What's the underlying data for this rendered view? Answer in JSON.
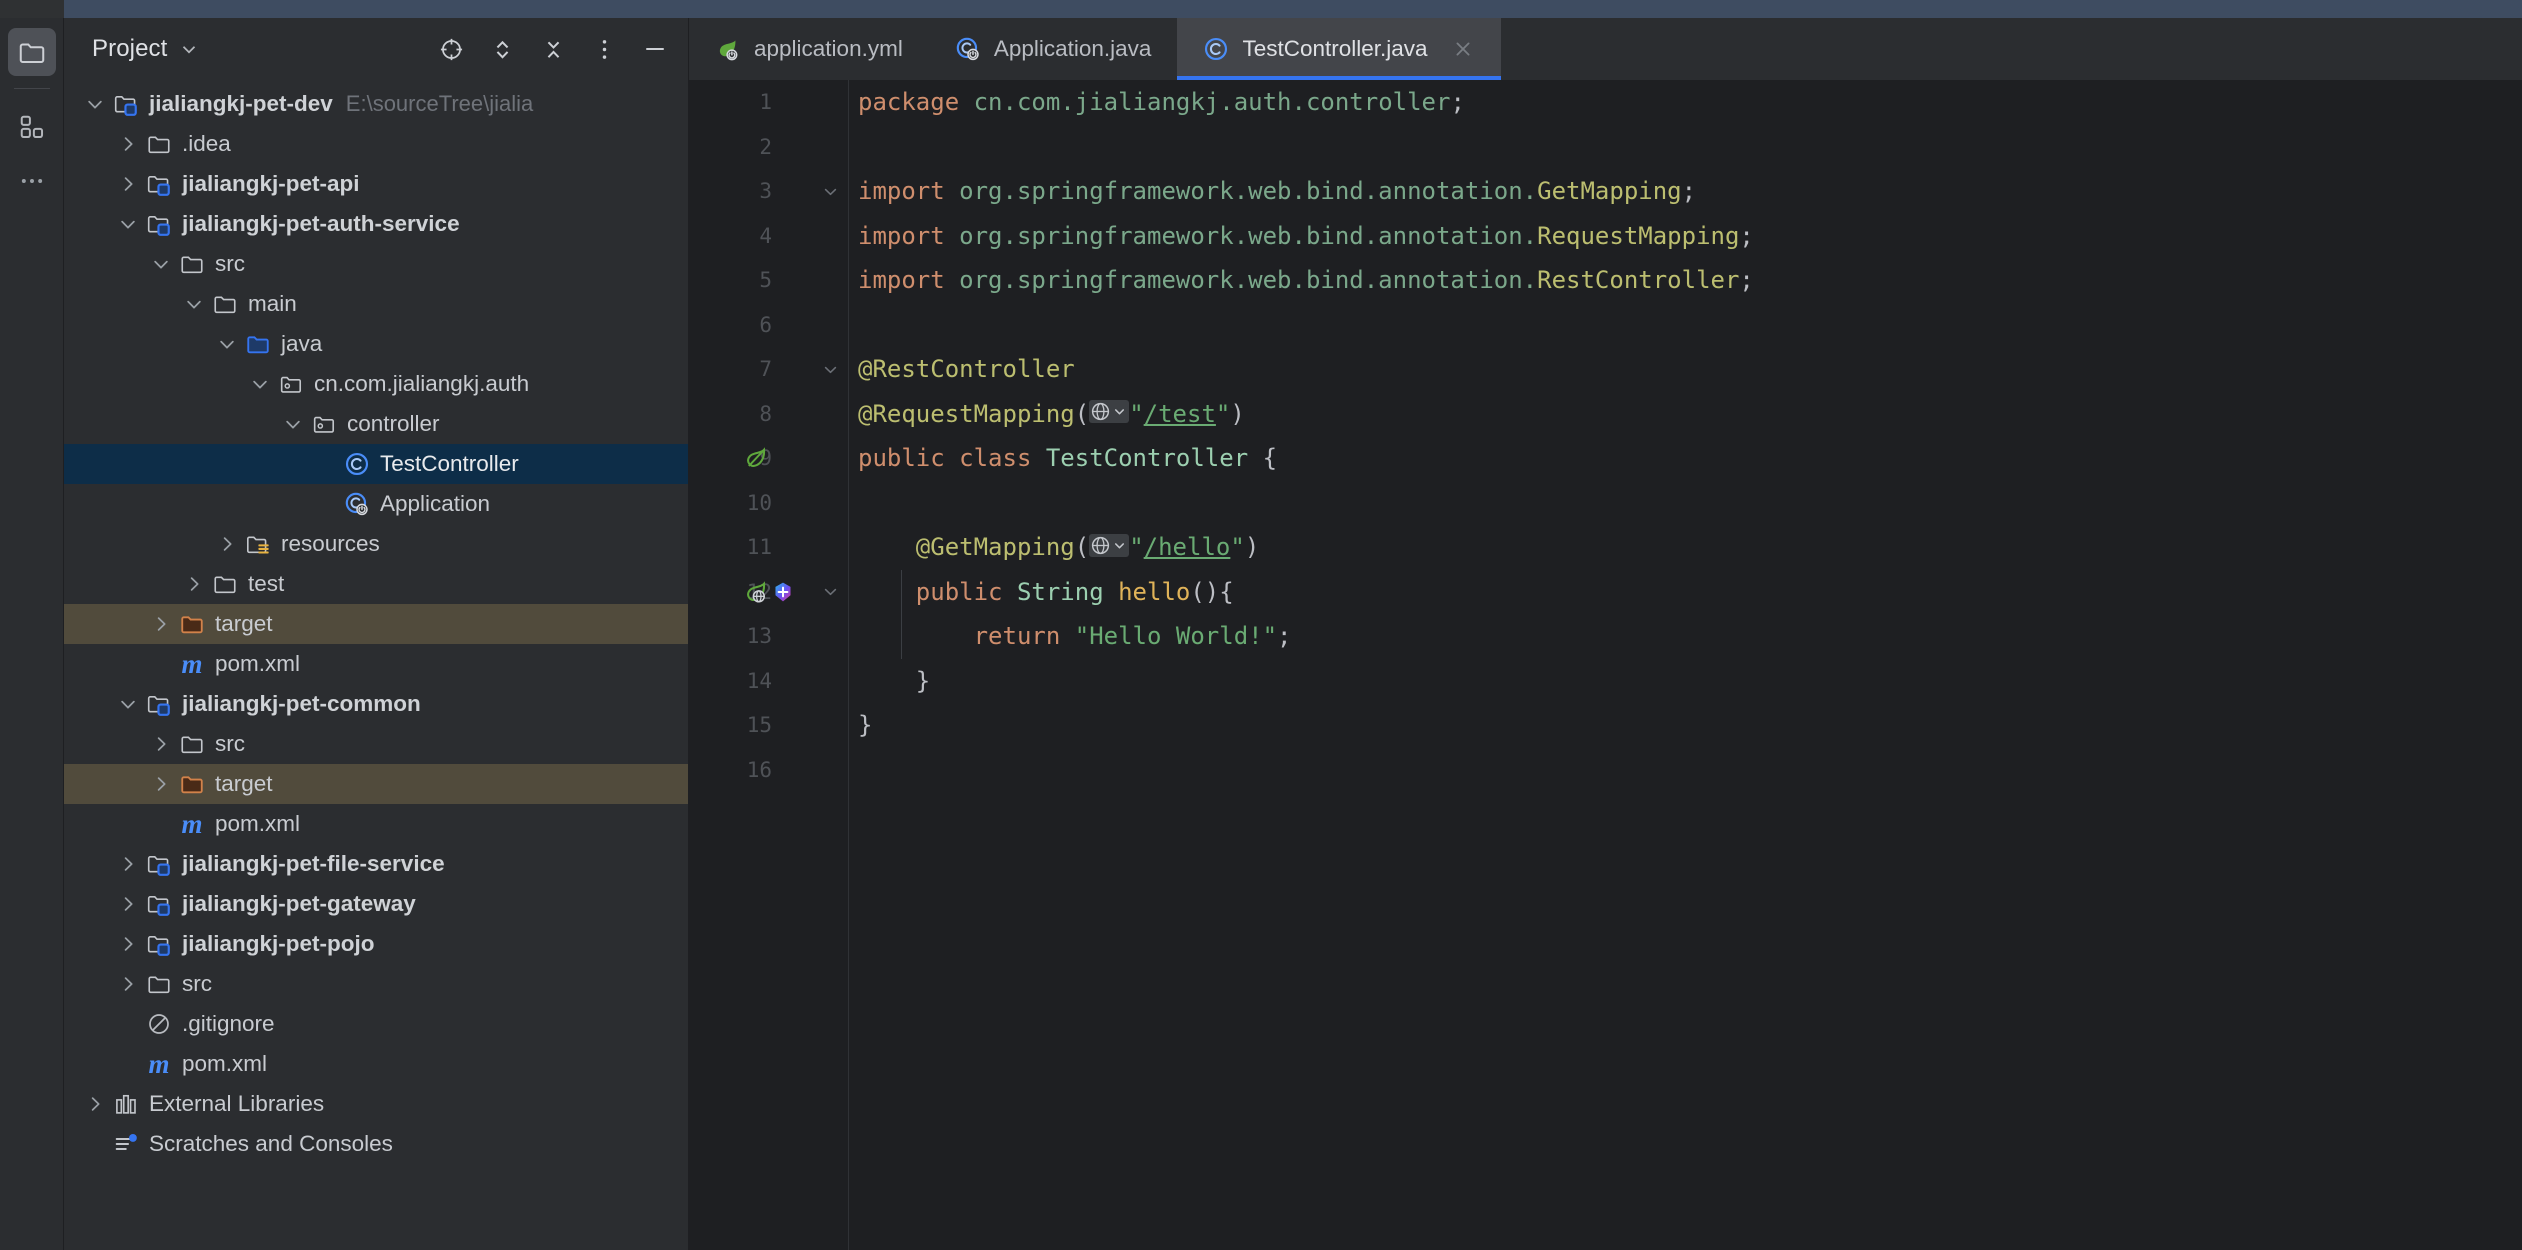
{
  "window": {
    "theme_bg": "#2b2d30",
    "editor_bg": "#1e1f22",
    "accent": "#3574f0",
    "selection_bg": "#0d2d48",
    "excluded_bg": "#514b3c"
  },
  "activity_bar": {
    "items": [
      {
        "name": "project-tool-window",
        "icon": "folder-icon",
        "active": true
      },
      {
        "name": "structure-tool-window",
        "icon": "structure-squares-icon",
        "active": false
      },
      {
        "name": "more-tool-windows",
        "icon": "ellipsis-icon",
        "active": false
      }
    ]
  },
  "project_panel": {
    "title": "Project",
    "dropdown_icon": "chevron-down-icon",
    "actions": [
      {
        "label": "Select Opened File",
        "icon": "crosshair-icon"
      },
      {
        "label": "Expand All",
        "icon": "expand-all-icon"
      },
      {
        "label": "Collapse All",
        "icon": "collapse-all-icon"
      },
      {
        "label": "Options",
        "icon": "vertical-dots-icon"
      },
      {
        "label": "Hide",
        "icon": "minimize-icon"
      }
    ],
    "tree": [
      {
        "label": "jialiangkj-pet-dev",
        "path": "E:\\sourceTree\\jialia",
        "indent": 0,
        "icon": "module-folder-icon",
        "arrow": "down",
        "bold": true
      },
      {
        "label": ".idea",
        "indent": 1,
        "icon": "folder-icon",
        "arrow": "right"
      },
      {
        "label": "jialiangkj-pet-api",
        "indent": 1,
        "icon": "module-folder-icon",
        "arrow": "right",
        "bold": true
      },
      {
        "label": "jialiangkj-pet-auth-service",
        "indent": 1,
        "icon": "module-folder-icon",
        "arrow": "down",
        "bold": true
      },
      {
        "label": "src",
        "indent": 2,
        "icon": "folder-icon",
        "arrow": "down"
      },
      {
        "label": "main",
        "indent": 3,
        "icon": "folder-icon",
        "arrow": "down"
      },
      {
        "label": "java",
        "indent": 4,
        "icon": "source-root-folder-icon",
        "arrow": "down"
      },
      {
        "label": "cn.com.jialiangkj.auth",
        "indent": 5,
        "icon": "package-folder-icon",
        "arrow": "down"
      },
      {
        "label": "controller",
        "indent": 6,
        "icon": "package-folder-icon",
        "arrow": "down"
      },
      {
        "label": "TestController",
        "indent": 7,
        "icon": "java-class-icon",
        "arrow": "none",
        "selected": true
      },
      {
        "label": "Application",
        "indent": 7,
        "icon": "spring-boot-class-icon",
        "arrow": "none"
      },
      {
        "label": "resources",
        "indent": 4,
        "icon": "resources-root-folder-icon",
        "arrow": "right"
      },
      {
        "label": "test",
        "indent": 3,
        "icon": "folder-icon",
        "arrow": "right"
      },
      {
        "label": "target",
        "indent": 2,
        "icon": "excluded-folder-icon",
        "arrow": "right",
        "highlight": true
      },
      {
        "label": "pom.xml",
        "indent": 2,
        "icon": "maven-icon",
        "arrow": "none"
      },
      {
        "label": "jialiangkj-pet-common",
        "indent": 1,
        "icon": "module-folder-icon",
        "arrow": "down",
        "bold": true
      },
      {
        "label": "src",
        "indent": 2,
        "icon": "folder-icon",
        "arrow": "right"
      },
      {
        "label": "target",
        "indent": 2,
        "icon": "excluded-folder-icon",
        "arrow": "right",
        "highlight": true
      },
      {
        "label": "pom.xml",
        "indent": 2,
        "icon": "maven-icon",
        "arrow": "none"
      },
      {
        "label": "jialiangkj-pet-file-service",
        "indent": 1,
        "icon": "module-folder-icon",
        "arrow": "right",
        "bold": true
      },
      {
        "label": "jialiangkj-pet-gateway",
        "indent": 1,
        "icon": "module-folder-icon",
        "arrow": "right",
        "bold": true
      },
      {
        "label": "jialiangkj-pet-pojo",
        "indent": 1,
        "icon": "module-folder-icon",
        "arrow": "right",
        "bold": true
      },
      {
        "label": "src",
        "indent": 1,
        "icon": "folder-icon",
        "arrow": "right"
      },
      {
        "label": ".gitignore",
        "indent": 1,
        "icon": "gitignore-icon",
        "arrow": "none"
      },
      {
        "label": "pom.xml",
        "indent": 1,
        "icon": "maven-icon",
        "arrow": "none"
      },
      {
        "label": "External Libraries",
        "indent": 0,
        "icon": "libraries-icon",
        "arrow": "right"
      },
      {
        "label": "Scratches and Consoles",
        "indent": 0,
        "icon": "scratches-icon",
        "arrow": "none"
      }
    ]
  },
  "editor": {
    "tabs": [
      {
        "label": "application.yml",
        "icon": "spring-yaml-icon",
        "active": false,
        "closable": false
      },
      {
        "label": "Application.java",
        "icon": "spring-boot-class-icon",
        "active": false,
        "closable": false
      },
      {
        "label": "TestController.java",
        "icon": "java-class-icon",
        "active": true,
        "closable": true,
        "close_icon": "close-icon"
      }
    ],
    "file_name": "TestController.java",
    "line_numbers": [
      1,
      2,
      3,
      4,
      5,
      6,
      7,
      8,
      9,
      10,
      11,
      12,
      13,
      14,
      15,
      16
    ],
    "gutter_icons": [
      {
        "line": 3,
        "icon": "fold-chevron-down-icon"
      },
      {
        "line": 7,
        "icon": "fold-chevron-down-icon"
      },
      {
        "line": 9,
        "icon": "spring-bean-icon"
      },
      {
        "line": 12,
        "icon": "spring-endpoint-icon"
      },
      {
        "line": 12,
        "icon": "implementation-gem-icon"
      },
      {
        "line": 12,
        "icon": "fold-chevron-down-icon"
      }
    ],
    "code_lines": [
      {
        "n": 1,
        "tokens": [
          {
            "t": "package",
            "c": "kw"
          },
          {
            "t": " ",
            "c": "pl"
          },
          {
            "t": "cn.com.jialiangkj.auth.controller",
            "c": "pkg"
          },
          {
            "t": ";",
            "c": "pl"
          }
        ]
      },
      {
        "n": 2,
        "tokens": []
      },
      {
        "n": 3,
        "tokens": [
          {
            "t": "import",
            "c": "kw"
          },
          {
            "t": " ",
            "c": "pl"
          },
          {
            "t": "org.springframework.web.bind.annotation.",
            "c": "pkg"
          },
          {
            "t": "GetMapping",
            "c": "cls"
          },
          {
            "t": ";",
            "c": "pl"
          }
        ]
      },
      {
        "n": 4,
        "tokens": [
          {
            "t": "import",
            "c": "kw"
          },
          {
            "t": " ",
            "c": "pl"
          },
          {
            "t": "org.springframework.web.bind.annotation.",
            "c": "pkg"
          },
          {
            "t": "RequestMapping",
            "c": "cls"
          },
          {
            "t": ";",
            "c": "pl"
          }
        ]
      },
      {
        "n": 5,
        "tokens": [
          {
            "t": "import",
            "c": "kw"
          },
          {
            "t": " ",
            "c": "pl"
          },
          {
            "t": "org.springframework.web.bind.annotation.",
            "c": "pkg"
          },
          {
            "t": "RestController",
            "c": "cls"
          },
          {
            "t": ";",
            "c": "pl"
          }
        ]
      },
      {
        "n": 6,
        "tokens": []
      },
      {
        "n": 7,
        "tokens": [
          {
            "t": "@RestController",
            "c": "ann"
          }
        ]
      },
      {
        "n": 8,
        "tokens": [
          {
            "t": "@RequestMapping",
            "c": "ann"
          },
          {
            "t": "(",
            "c": "pl"
          },
          {
            "t": "GLOBE",
            "c": "globe"
          },
          {
            "t": "\"",
            "c": "str"
          },
          {
            "t": "/test",
            "c": "strlink"
          },
          {
            "t": "\"",
            "c": "str"
          },
          {
            "t": ")",
            "c": "pl"
          }
        ]
      },
      {
        "n": 9,
        "tokens": [
          {
            "t": "public",
            "c": "kw"
          },
          {
            "t": " ",
            "c": "pl"
          },
          {
            "t": "class",
            "c": "kw"
          },
          {
            "t": " ",
            "c": "pl"
          },
          {
            "t": "TestController",
            "c": "typ"
          },
          {
            "t": " {",
            "c": "pl"
          }
        ]
      },
      {
        "n": 10,
        "tokens": []
      },
      {
        "n": 11,
        "tokens": [
          {
            "t": "    ",
            "c": "pl"
          },
          {
            "t": "@GetMapping",
            "c": "ann"
          },
          {
            "t": "(",
            "c": "pl"
          },
          {
            "t": "GLOBE",
            "c": "globe"
          },
          {
            "t": "\"",
            "c": "str"
          },
          {
            "t": "/hello",
            "c": "strlink"
          },
          {
            "t": "\"",
            "c": "str"
          },
          {
            "t": ")",
            "c": "pl"
          }
        ]
      },
      {
        "n": 12,
        "tokens": [
          {
            "t": "    ",
            "c": "pl"
          },
          {
            "t": "public",
            "c": "kw"
          },
          {
            "t": " ",
            "c": "pl"
          },
          {
            "t": "String",
            "c": "typ"
          },
          {
            "t": " ",
            "c": "pl"
          },
          {
            "t": "hello",
            "c": "mth"
          },
          {
            "t": "(){",
            "c": "pl"
          }
        ]
      },
      {
        "n": 13,
        "tokens": [
          {
            "t": "        ",
            "c": "pl"
          },
          {
            "t": "return",
            "c": "kw"
          },
          {
            "t": " ",
            "c": "pl"
          },
          {
            "t": "\"Hello World!\"",
            "c": "str"
          },
          {
            "t": ";",
            "c": "pl"
          }
        ]
      },
      {
        "n": 14,
        "tokens": [
          {
            "t": "    }",
            "c": "pl"
          }
        ]
      },
      {
        "n": 15,
        "tokens": [
          {
            "t": "}",
            "c": "pl"
          }
        ]
      },
      {
        "n": 16,
        "tokens": []
      }
    ],
    "syntax_colors": {
      "keyword": "#cf8e6d",
      "package": "#7ba88b",
      "class_ref": "#bcbe70",
      "annotation": "#bcbe70",
      "type": "#9ccfb0",
      "method": "#e0b359",
      "string": "#6aab73",
      "plain": "#bcbec4",
      "line_number": "#4f5257"
    }
  }
}
